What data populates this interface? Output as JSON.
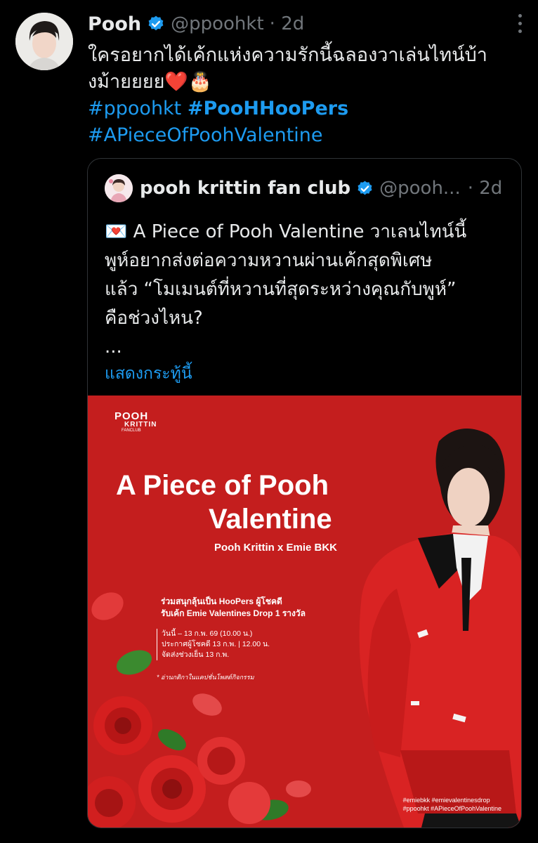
{
  "tweet": {
    "author_name": "Pooh",
    "handle": "@ppoohkt",
    "time": "· 2d",
    "text_lines": [
      "ใครอยากได้เค้กแห่งความรักนี้ฉลองวาเล่นไทน์บ้า",
      "งม้ายยยย❤️🎂"
    ],
    "hashtags": [
      "#ppoohkt",
      "#PooHHooPers",
      "#APieceOfPoohValentine"
    ]
  },
  "quote": {
    "author_name": "pooh krittin fan club",
    "handle": "@pooh...",
    "time": "· 2d",
    "text_lines": [
      "💌 A Piece of Pooh Valentine วาเลนไทน์นี้",
      "พูห์อยากส่งต่อความหวานผ่านเค้กสุดพิเศษ",
      "แล้ว “โมเมนต์ที่หวานที่สุดระหว่างคุณกับพูห์”",
      "คือช่วงไหน?",
      "..."
    ],
    "show_more": "แสดงกระทู้นี้"
  },
  "poster": {
    "logo": [
      "POOH",
      "KRITTIN",
      "FANCLUB"
    ],
    "title_line1": "A Piece of Pooh",
    "title_line2": "Valentine",
    "subtitle": "Pooh Krittin x Emie BKK",
    "promo_lines": [
      "ร่วมสนุกลุ้นเป็น HooPers ผู้โชคดี",
      "รับเค้ก Emie Valentines Drop 1 รางวัล"
    ],
    "date_lines": [
      "วันนี้ – 13 ก.พ. 69 (10.00 น.)",
      "ประกาศผู้โชคดี 13 ก.พ. | 12.00 น.",
      "จัดส่งช่วงเย็น 13 ก.พ."
    ],
    "note": "*  อ่านกติกาในแคปชั่นโพสต์กิจกรรม",
    "hashtag_lines": [
      "#emiebkk #emievalentinesdrop",
      "#ppoohkt #APieceOfPoohValentine"
    ]
  },
  "colors": {
    "background": "#000000",
    "link": "#1d9bf0",
    "verified": "#1d9bf0",
    "muted": "#71767b",
    "poster_red": "#c41e1e"
  }
}
